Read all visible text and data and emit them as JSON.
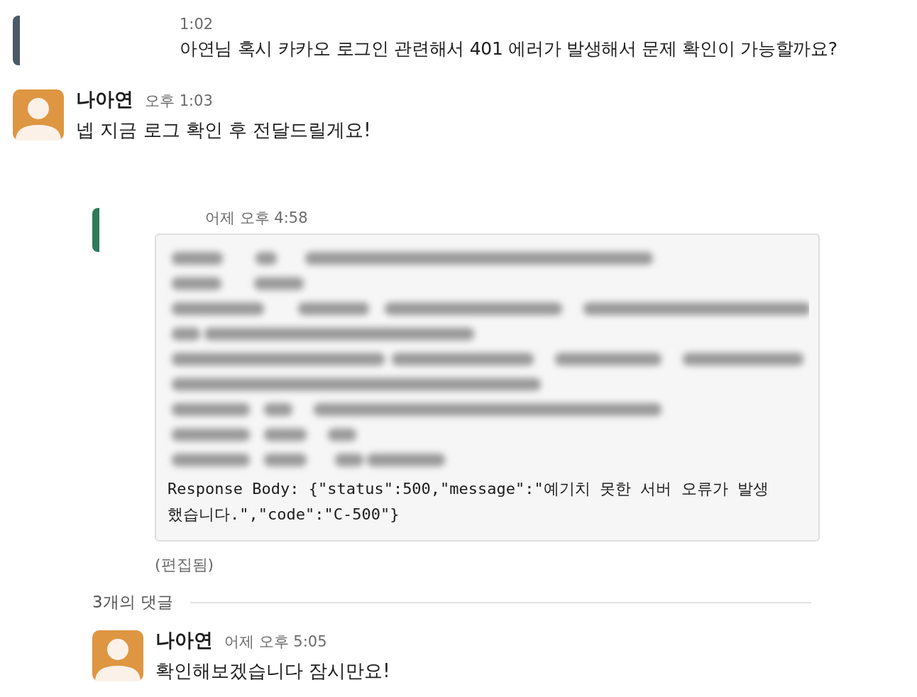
{
  "messages": [
    {
      "kind": "continuation",
      "time": "1:02",
      "text": "아연님 혹시 카카오 로그인 관련해서 401 에러가 발생해서 문제 확인이 가능할까요?"
    },
    {
      "kind": "full",
      "author": "나아연",
      "time": "오후 1:03",
      "text": "넵 지금 로그 확인 후 전달드릴게요!"
    }
  ],
  "thread": {
    "time": "어제 오후 4:58",
    "code_lines": [
      "Response Body: {\"status\":500,\"message\":\"예기치 못한 서버 오류가 발생",
      "했습니다.\",\"code\":\"C-500\"}"
    ],
    "edited": "(편집됨)",
    "reply_count": "3개의 댓글",
    "replies": [
      {
        "author": "나아연",
        "time": "어제 오후 5:05",
        "text": "확인해보겠습니다 잠시만요!"
      }
    ]
  }
}
